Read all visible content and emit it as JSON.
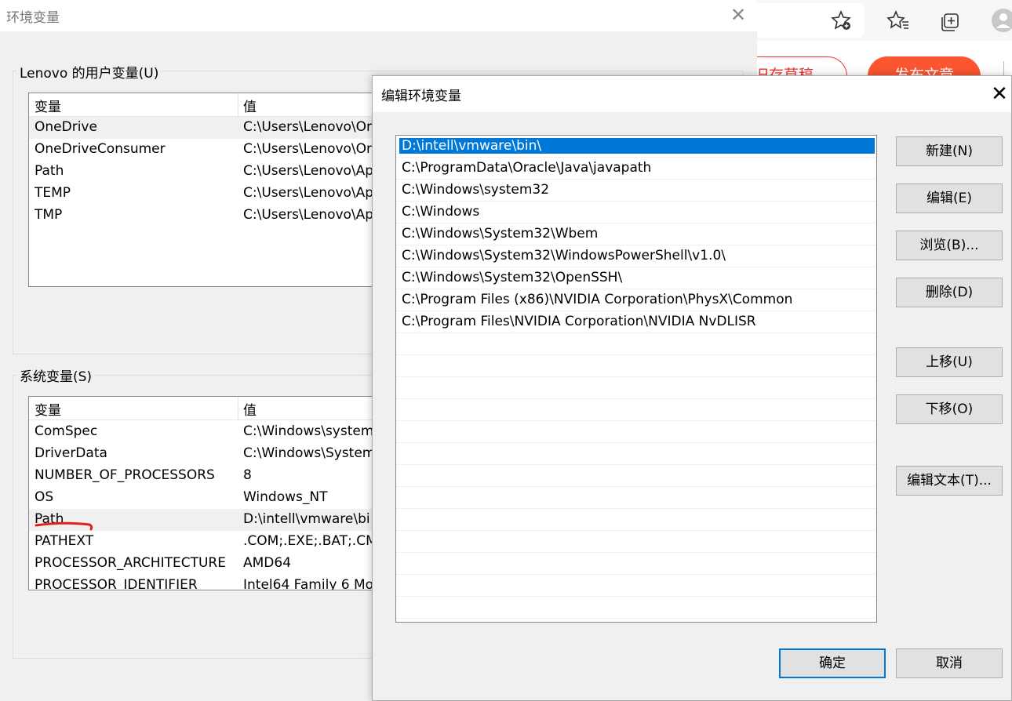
{
  "browser": {
    "icons": [
      "favorite-add-icon",
      "favorites-icon",
      "collections-icon",
      "profile-icon"
    ],
    "draft_button": "旧存草稿",
    "publish_button": "发布文章",
    "accent": "#fc5531"
  },
  "env_dialog": {
    "title": "环境变量",
    "close_glyph": "✕",
    "user_group_label": "Lenovo 的用户变量(U)",
    "system_group_label": "系统变量(S)",
    "columns": [
      "变量",
      "值"
    ],
    "user_vars": [
      {
        "name": "OneDrive",
        "value": "C:\\Users\\Lenovo\\Or"
      },
      {
        "name": "OneDriveConsumer",
        "value": "C:\\Users\\Lenovo\\Or"
      },
      {
        "name": "Path",
        "value": "C:\\Users\\Lenovo\\Ap"
      },
      {
        "name": "TEMP",
        "value": "C:\\Users\\Lenovo\\Ap"
      },
      {
        "name": "TMP",
        "value": "C:\\Users\\Lenovo\\Ap"
      }
    ],
    "system_vars": [
      {
        "name": "ComSpec",
        "value": "C:\\Windows\\system"
      },
      {
        "name": "DriverData",
        "value": "C:\\Windows\\System"
      },
      {
        "name": "NUMBER_OF_PROCESSORS",
        "value": "8"
      },
      {
        "name": "OS",
        "value": "Windows_NT"
      },
      {
        "name": "Path",
        "value": "D:\\intell\\vmware\\bi"
      },
      {
        "name": "PATHEXT",
        "value": ".COM;.EXE;.BAT;.CM"
      },
      {
        "name": "PROCESSOR_ARCHITECTURE",
        "value": "AMD64"
      },
      {
        "name": "PROCESSOR_IDENTIFIER",
        "value": "Intel64 Family 6 Mo"
      }
    ]
  },
  "edit_dialog": {
    "title": "编辑环境变量",
    "close_glyph": "✕",
    "paths": [
      "D:\\intell\\vmware\\bin\\",
      "C:\\ProgramData\\Oracle\\Java\\javapath",
      "C:\\Windows\\system32",
      "C:\\Windows",
      "C:\\Windows\\System32\\Wbem",
      "C:\\Windows\\System32\\WindowsPowerShell\\v1.0\\",
      "C:\\Windows\\System32\\OpenSSH\\",
      "C:\\Program Files (x86)\\NVIDIA Corporation\\PhysX\\Common",
      "C:\\Program Files\\NVIDIA Corporation\\NVIDIA NvDLISR"
    ],
    "buttons": {
      "new": "新建(N)",
      "edit": "编辑(E)",
      "browse": "浏览(B)...",
      "delete": "删除(D)",
      "move_up": "上移(U)",
      "move_down": "下移(O)",
      "edit_text": "编辑文本(T)...",
      "ok": "确定",
      "cancel": "取消"
    },
    "selection_color": "#0078d7"
  }
}
